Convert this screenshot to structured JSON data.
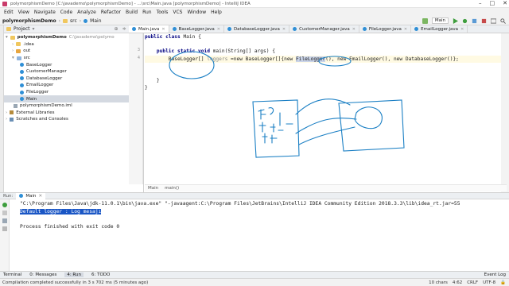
{
  "window": {
    "title": "polymorphismDemo [C:\\javademo\\polymorphismDemo] - ...\\src\\Main.java [polymorphismDemo] - IntelliJ IDEA"
  },
  "menu": [
    "Edit",
    "View",
    "Navigate",
    "Code",
    "Analyze",
    "Refactor",
    "Build",
    "Run",
    "Tools",
    "VCS",
    "Window",
    "Help"
  ],
  "navbar": {
    "crumbs": [
      "polymorphismDemo",
      "src",
      "Main"
    ],
    "run_config": "Main"
  },
  "project": {
    "header": "Project",
    "root": "polymorphismDemo",
    "root_path": "C:\\javademo\\polymo",
    "items": [
      ".idea",
      "out",
      "src",
      "BaseLogger",
      "CustomerManager",
      "DatabaseLogger",
      "EmailLogger",
      "FileLogger",
      "Main",
      "polymorphismDemo.iml",
      "External Libraries",
      "Scratches and Consoles"
    ]
  },
  "tabs": [
    "Main.java",
    "BaseLogger.java",
    "DatabaseLogger.java",
    "CustomerManager.java",
    "FileLogger.java",
    "EmailLogger.java"
  ],
  "gutter": [
    "",
    "",
    "3",
    "4",
    "",
    "",
    "",
    "",
    "",
    ""
  ],
  "code": {
    "l1a": "public class ",
    "l1b": "Main {",
    "l3a": "    public static void ",
    "l3b": "main(String[] args) {",
    "l4a": "        BaseLogger[] ",
    "l4b": "loggers",
    "l4c": " =new BaseLogger[]{new ",
    "l4d": "FileLogger",
    "l4e": "(), new EmailLogger(), new DatabaseLogger()};",
    "l6": "    }",
    "l7": "}"
  },
  "breadcrumb": [
    "Main",
    "main()"
  ],
  "run": {
    "tab": "Main",
    "lines": [
      "\"C:\\Program Files\\Java\\jdk-11.0.1\\bin\\java.exe\" \"-javaagent:C:\\Program Files\\JetBrains\\IntelliJ IDEA Community Edition 2018.3.3\\lib\\idea_rt.jar=55",
      "Default logger : Log mesajı",
      "",
      "Process finished with exit code 0"
    ]
  },
  "bottom_tabs": [
    "Terminal",
    "0: Messages",
    "4: Run",
    "6: TODO"
  ],
  "event_log": "Event Log",
  "status": {
    "message": "Compilation completed successfully in 3 s 702 ms (5 minutes ago)",
    "chars": "10 chars",
    "pos": "4:62",
    "crlf": "CRLF",
    "enc": "UTF-8"
  },
  "colors": {
    "accent": "#1a56c5",
    "annotation_ink": "#1a7fc4",
    "keyword": "#000080"
  }
}
